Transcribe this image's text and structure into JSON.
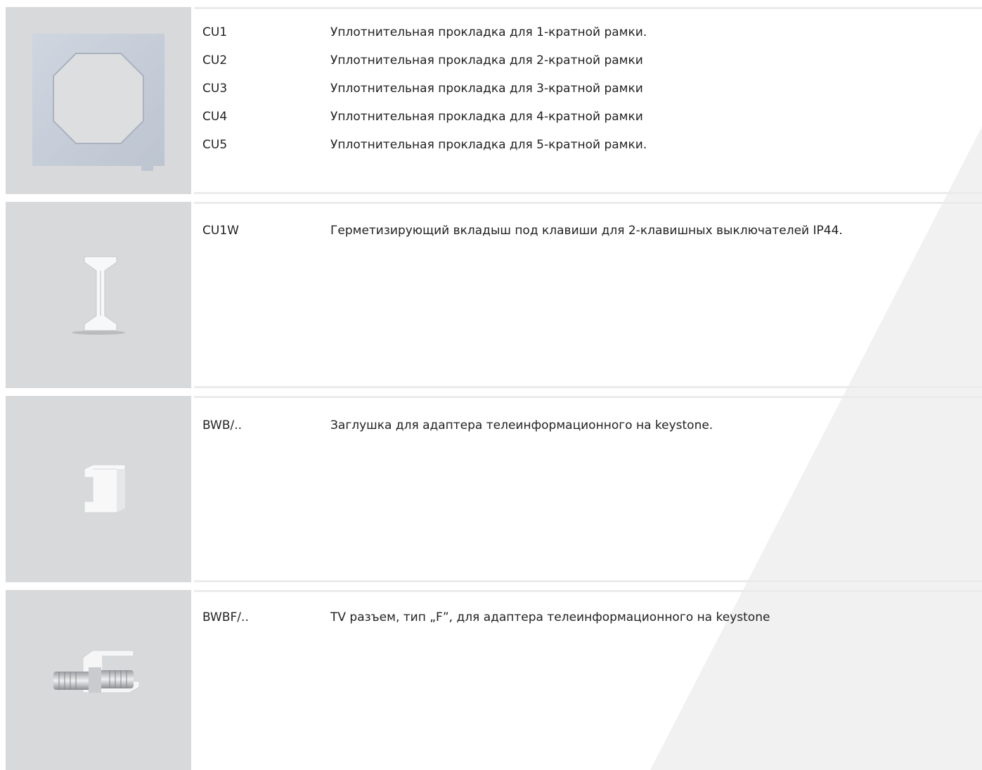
{
  "colors": {
    "image_bg": "#d8d9da",
    "divider": "#ebebeb",
    "diagonal_shade": "#f1f1f2",
    "text": "#222222"
  },
  "rows": [
    {
      "image_icon": "sealing-gasket-frame-icon",
      "items": [
        {
          "code": "CU1",
          "desc": "Уплотнительная прокладка для 1-кратной рамки."
        },
        {
          "code": "CU2",
          "desc": "Уплотнительная прокладка для 2-кратной рамки"
        },
        {
          "code": "CU3",
          "desc": "Уплотнительная прокладка для 3-кратной рамки"
        },
        {
          "code": "CU4",
          "desc": "Уплотнительная прокладка для 4-кратной рамки"
        },
        {
          "code": "CU5",
          "desc": "Уплотнительная прокладка для 5-кратной рамки."
        }
      ]
    },
    {
      "image_icon": "sealing-insert-icon",
      "items": [
        {
          "code": "CU1W",
          "desc": "Герметизирующий вкладыш под клавиши для 2-клавишных выключателей IP44."
        }
      ]
    },
    {
      "image_icon": "keystone-blank-plug-icon",
      "items": [
        {
          "code": "BWB/..",
          "desc": "Заглушка для адаптера телеинформационного на keystone."
        }
      ]
    },
    {
      "image_icon": "tv-f-connector-icon",
      "items": [
        {
          "code": "BWBF/..",
          "desc": "TV разъем, тип „F”, для адаптера телеинформационного на keystone"
        }
      ]
    }
  ]
}
